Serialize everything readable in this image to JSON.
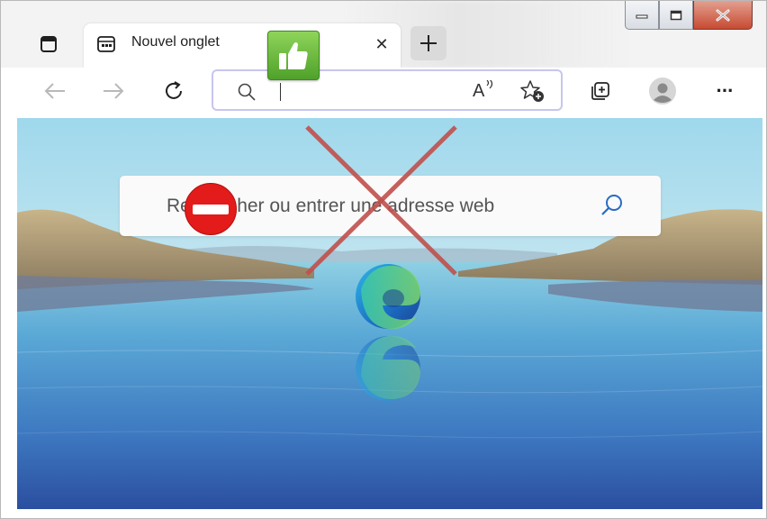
{
  "tab": {
    "title": "Nouvel onglet",
    "close_glyph": "✕"
  },
  "newtab": {
    "glyph": "+"
  },
  "window_controls": {
    "minimize": "minimize-icon",
    "maximize": "maximize-icon",
    "close": "close-icon"
  },
  "toolbar": {
    "back": "back-arrow-icon",
    "forward": "forward-arrow-icon",
    "refresh": "refresh-icon",
    "read_aloud_glyph": "A",
    "favorites": "favorites-add-icon",
    "collections": "collections-icon",
    "profile": "profile-avatar-icon",
    "menu_glyph": "···"
  },
  "addressbar": {
    "search_icon": "search-icon",
    "value": "",
    "caret": true
  },
  "newtab_page": {
    "search_placeholder": "Rechercher ou entrer une adresse web",
    "logo": "edge-logo-icon"
  },
  "annotations": {
    "thumbs_up": "thumbs-up-icon",
    "no_entry": "no-entry-icon",
    "cross_color": "#c0504d",
    "thumb_color": "#5fb332",
    "noentry_color": "#e31b1b"
  },
  "colors": {
    "accent": "#c7c6ee",
    "tab_bg": "#ffffff",
    "strip_bg": "#f3f3f3"
  }
}
